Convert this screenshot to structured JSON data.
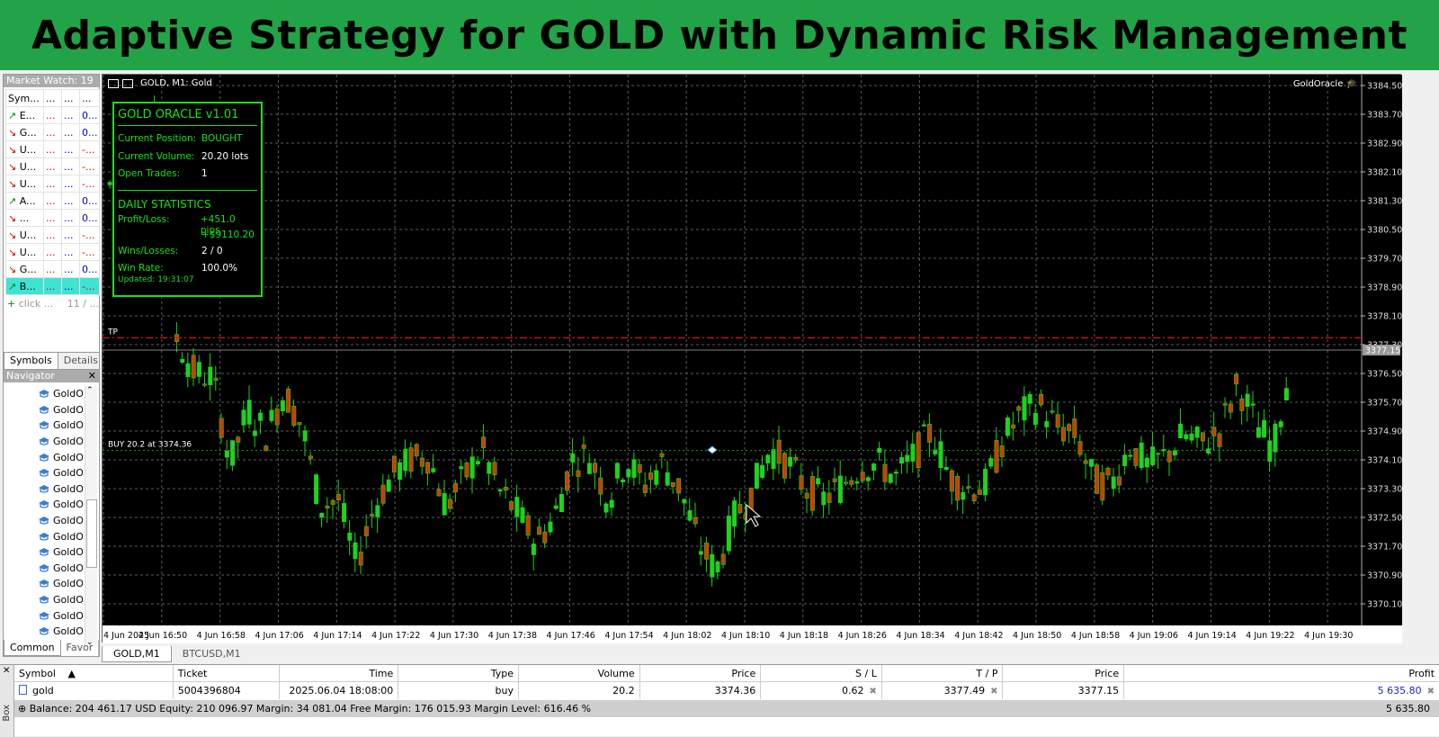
{
  "banner": {
    "title": "Adaptive Strategy for GOLD with Dynamic Risk Management"
  },
  "market_watch": {
    "title": "Market Watch: 19",
    "headers": [
      "Sym...",
      "...",
      "...",
      "..."
    ],
    "rows": [
      {
        "dir": "up",
        "sym": "E...",
        "bid": "...",
        "ask": "...",
        "chg": "0..."
      },
      {
        "dir": "dn",
        "sym": "G...",
        "bid": "...",
        "ask": "...",
        "chg": "0..."
      },
      {
        "dir": "dn",
        "sym": "U...",
        "bid": "...",
        "ask": "...",
        "chg": "-..."
      },
      {
        "dir": "dn",
        "sym": "U...",
        "bid": "...",
        "ask": "...",
        "chg": "-..."
      },
      {
        "dir": "dn",
        "sym": "U...",
        "bid": "...",
        "ask": "...",
        "chg": "-..."
      },
      {
        "dir": "up",
        "sym": "A...",
        "bid": "...",
        "ask": "...",
        "chg": "0..."
      },
      {
        "dir": "dn",
        "sym": "...",
        "bid": "...",
        "ask": "...",
        "chg": "0..."
      },
      {
        "dir": "dn",
        "sym": "U...",
        "bid": "...",
        "ask": "...",
        "chg": "-..."
      },
      {
        "dir": "dn",
        "sym": "U...",
        "bid": "...",
        "ask": "...",
        "chg": "-..."
      },
      {
        "dir": "dn",
        "sym": "G...",
        "bid": "...",
        "ask": "...",
        "chg": "0..."
      },
      {
        "dir": "up",
        "sym": "B...",
        "bid": "...",
        "ask": "...",
        "chg": "-..."
      }
    ],
    "add_label": "click ...",
    "count": "11 / ...",
    "tabs": [
      "Symbols",
      "Details"
    ]
  },
  "navigator": {
    "title": "Navigator",
    "items": [
      "GoldO",
      "GoldO",
      "GoldO",
      "GoldO",
      "GoldO",
      "GoldO",
      "GoldO",
      "GoldO",
      "GoldO",
      "GoldO",
      "GoldO",
      "GoldO",
      "GoldO",
      "GoldO",
      "GoldO",
      "GoldO"
    ],
    "tabs": [
      "Common",
      "Favor"
    ]
  },
  "chart": {
    "symbol_label": "GOLD, M1:  Gold",
    "ea_name": "GoldOracle",
    "price_labels": [
      "3384.50",
      "3383.70",
      "3382.90",
      "3382.10",
      "3381.30",
      "3380.50",
      "3379.70",
      "3378.90",
      "3378.10",
      "3377.30",
      "3376.50",
      "3375.70",
      "3374.90",
      "3374.10",
      "3373.30",
      "3372.50",
      "3371.70",
      "3370.90",
      "3370.10"
    ],
    "current_price": "3377.15",
    "time_labels": [
      "4 Jun 2025",
      "4 Jun 16:50",
      "4 Jun 16:58",
      "4 Jun 17:06",
      "4 Jun 17:14",
      "4 Jun 17:22",
      "4 Jun 17:30",
      "4 Jun 17:38",
      "4 Jun 17:46",
      "4 Jun 17:54",
      "4 Jun 18:02",
      "4 Jun 18:10",
      "4 Jun 18:18",
      "4 Jun 18:26",
      "4 Jun 18:34",
      "4 Jun 18:42",
      "4 Jun 18:50",
      "4 Jun 18:58",
      "4 Jun 19:06",
      "4 Jun 19:14",
      "4 Jun 19:22",
      "4 Jun 19:30"
    ],
    "tp_label": "TP",
    "tp_price": 3377.49,
    "buy_label": "BUY 20.2 at 3374.36",
    "buy_price": 3374.36,
    "colors": {
      "bull": "#1fd21f",
      "bear": "#d23a00",
      "grid": "#5a5a5a",
      "tp": "#e01010",
      "entry": "#1fa01f"
    }
  },
  "panel": {
    "title": "GOLD ORACLE v1.01",
    "position_label": "Current Position:",
    "position_value": "BOUGHT",
    "volume_label": "Current Volume:",
    "volume_value": "20.20 lots",
    "trades_label": "Open Trades:",
    "trades_value": "1",
    "daily_title": "DAILY STATISTICS",
    "pl_label": "Profit/Loss:",
    "pl_pips": "+451.0 pips",
    "pl_usd": "+$9110.20",
    "wl_label": "Wins/Losses:",
    "wl_value": "2 / 0",
    "wr_label": "Win Rate:",
    "wr_value": "100.0%",
    "updated": "Updated: 19:31:07"
  },
  "chart_tabs": [
    "GOLD,M1",
    "BTCUSD,M1"
  ],
  "toolbox": {
    "side_label": "Box",
    "headers": [
      "Symbol",
      "Ticket",
      "Time",
      "Type",
      "Volume",
      "Price",
      "S / L",
      "T / P",
      "Price",
      "Profit"
    ],
    "row": {
      "symbol": "gold",
      "ticket": "5004396804",
      "time": "2025.06.04 18:08:00",
      "type": "buy",
      "volume": "20.2",
      "price": "3374.36",
      "sl": "0.62",
      "tp": "3377.49",
      "cur_price": "3377.15",
      "profit": "5 635.80"
    },
    "balance_line": "Balance: 204 461.17 USD  Equity: 210 096.97  Margin: 34 081.04  Free Margin: 176 015.93  Margin Level: 616.46 %",
    "total_profit": "5 635.80"
  }
}
